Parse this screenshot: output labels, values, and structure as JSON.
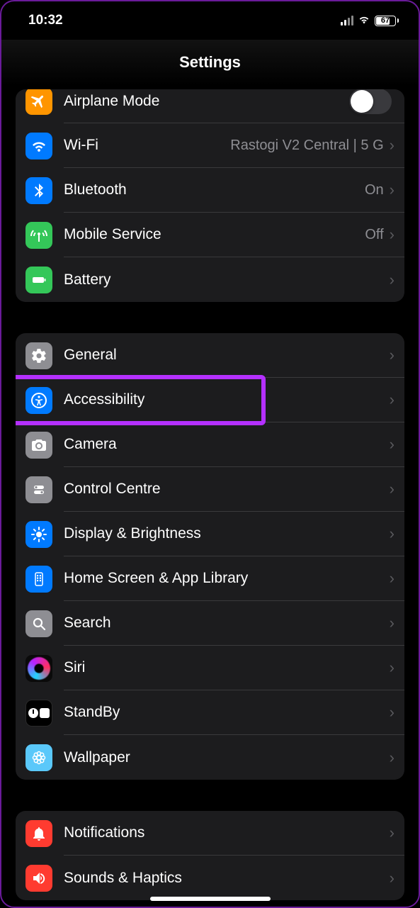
{
  "status": {
    "time": "10:32",
    "battery": "67"
  },
  "header": {
    "title": "Settings"
  },
  "groups": [
    {
      "items": [
        {
          "icon": "airplane",
          "label": "Airplane Mode",
          "control": "toggle",
          "toggle_on": false
        },
        {
          "icon": "wifi",
          "label": "Wi-Fi",
          "value": "Rastogi V2 Central |  5 G",
          "chevron": true
        },
        {
          "icon": "bluetooth",
          "label": "Bluetooth",
          "value": "On",
          "chevron": true
        },
        {
          "icon": "mobile",
          "label": "Mobile Service",
          "value": "Off",
          "chevron": true
        },
        {
          "icon": "battery",
          "label": "Battery",
          "chevron": true
        }
      ]
    },
    {
      "items": [
        {
          "icon": "general",
          "label": "General",
          "chevron": true
        },
        {
          "icon": "accessibility",
          "label": "Accessibility",
          "chevron": true,
          "highlight": true
        },
        {
          "icon": "camera",
          "label": "Camera",
          "chevron": true
        },
        {
          "icon": "controlcentre",
          "label": "Control Centre",
          "chevron": true
        },
        {
          "icon": "display",
          "label": "Display & Brightness",
          "chevron": true
        },
        {
          "icon": "homescreen",
          "label": "Home Screen & App Library",
          "chevron": true
        },
        {
          "icon": "search",
          "label": "Search",
          "chevron": true
        },
        {
          "icon": "siri",
          "label": "Siri",
          "chevron": true
        },
        {
          "icon": "standby",
          "label": "StandBy",
          "chevron": true
        },
        {
          "icon": "wallpaper",
          "label": "Wallpaper",
          "chevron": true
        }
      ]
    },
    {
      "items": [
        {
          "icon": "notifications",
          "label": "Notifications",
          "chevron": true
        },
        {
          "icon": "sounds",
          "label": "Sounds & Haptics",
          "chevron": true
        }
      ]
    }
  ]
}
